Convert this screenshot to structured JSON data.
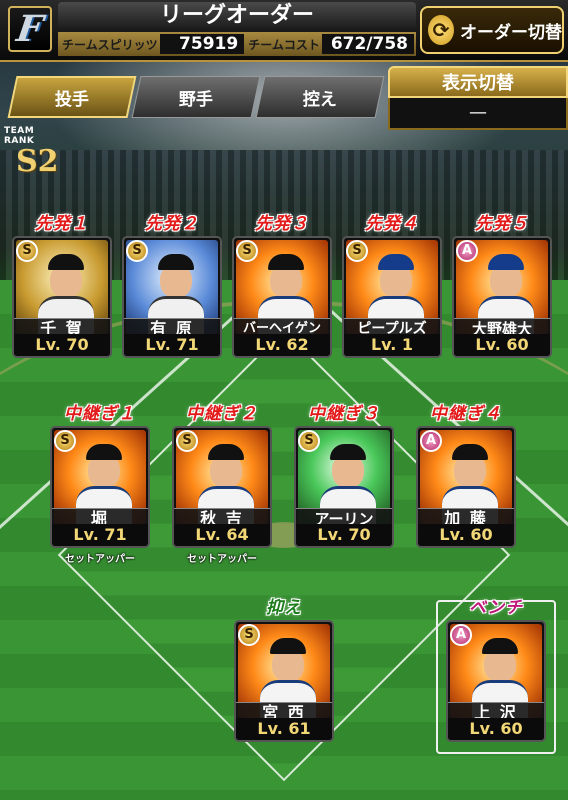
{
  "header": {
    "logo_letter": "F",
    "title": "リーグオーダー",
    "spirit_label": "チームスピリッツ",
    "spirit_value": "75919",
    "cost_label": "チームコスト",
    "cost_value": "672/758",
    "order_switch_label": "オーダー切替"
  },
  "tabs": [
    {
      "label": "投手",
      "active": true
    },
    {
      "label": "野手",
      "active": false
    },
    {
      "label": "控え",
      "active": false
    }
  ],
  "display_switch": {
    "title": "表示切替",
    "value": "—"
  },
  "team_rank": {
    "label": "TEAM RANK",
    "value": "S2"
  },
  "starters": [
    {
      "slot": "先発１",
      "rarity": "S",
      "name": "千 賀",
      "level": "Lv. 70",
      "bg": "gold"
    },
    {
      "slot": "先発２",
      "rarity": "S",
      "name": "有 原",
      "level": "Lv. 71",
      "bg": "blue"
    },
    {
      "slot": "先発３",
      "rarity": "S",
      "name": "バーヘイゲン",
      "level": "Lv. 62",
      "bg": "fire"
    },
    {
      "slot": "先発４",
      "rarity": "S",
      "name": "ピープルズ",
      "level": "Lv.  1",
      "bg": "fire"
    },
    {
      "slot": "先発５",
      "rarity": "A",
      "name": "大野雄大",
      "level": "Lv. 60",
      "bg": "fire"
    }
  ],
  "middle_relievers": [
    {
      "slot": "中継ぎ１",
      "rarity": "S",
      "name": "堀",
      "level": "Lv. 71",
      "bg": "fire",
      "note": "セットアッパー"
    },
    {
      "slot": "中継ぎ２",
      "rarity": "S",
      "name": "秋 吉",
      "level": "Lv. 64",
      "bg": "fire",
      "note": "セットアッパー"
    },
    {
      "slot": "中継ぎ３",
      "rarity": "S",
      "name": "アーリン",
      "level": "Lv. 70",
      "bg": "green",
      "note": ""
    },
    {
      "slot": "中継ぎ４",
      "rarity": "A",
      "name": "加 藤",
      "level": "Lv. 60",
      "bg": "fire",
      "note": ""
    }
  ],
  "closer": {
    "slot": "抑え",
    "rarity": "S",
    "name": "宮 西",
    "level": "Lv. 61",
    "bg": "fire"
  },
  "bench": {
    "slot": "ベンチ",
    "rarity": "A",
    "name": "上 沢",
    "level": "Lv. 60",
    "bg": "fire"
  }
}
